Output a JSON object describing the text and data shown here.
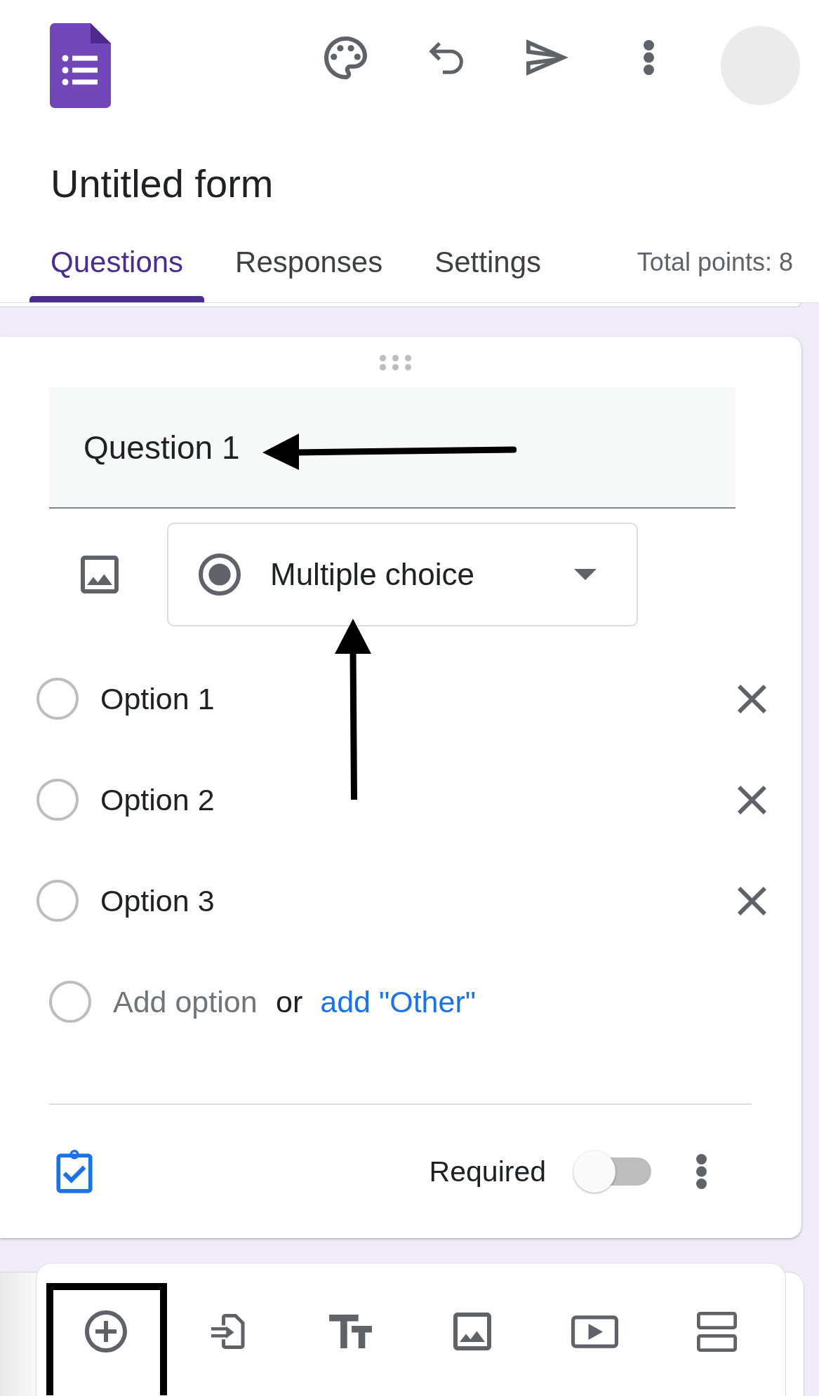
{
  "form": {
    "title": "Untitled form"
  },
  "tabs": [
    {
      "label": "Questions",
      "selected": true
    },
    {
      "label": "Responses",
      "selected": false
    },
    {
      "label": "Settings",
      "selected": false
    }
  ],
  "total_points": "Total points: 8",
  "question": {
    "title": "Question 1",
    "type": "Multiple choice",
    "options": [
      {
        "label": "Option 1"
      },
      {
        "label": "Option 2"
      },
      {
        "label": "Option 3"
      }
    ],
    "add_option": {
      "placeholder": "Add option",
      "separator": "or",
      "other_link": "add \"Other\""
    },
    "required": {
      "label": "Required",
      "on": false
    }
  }
}
